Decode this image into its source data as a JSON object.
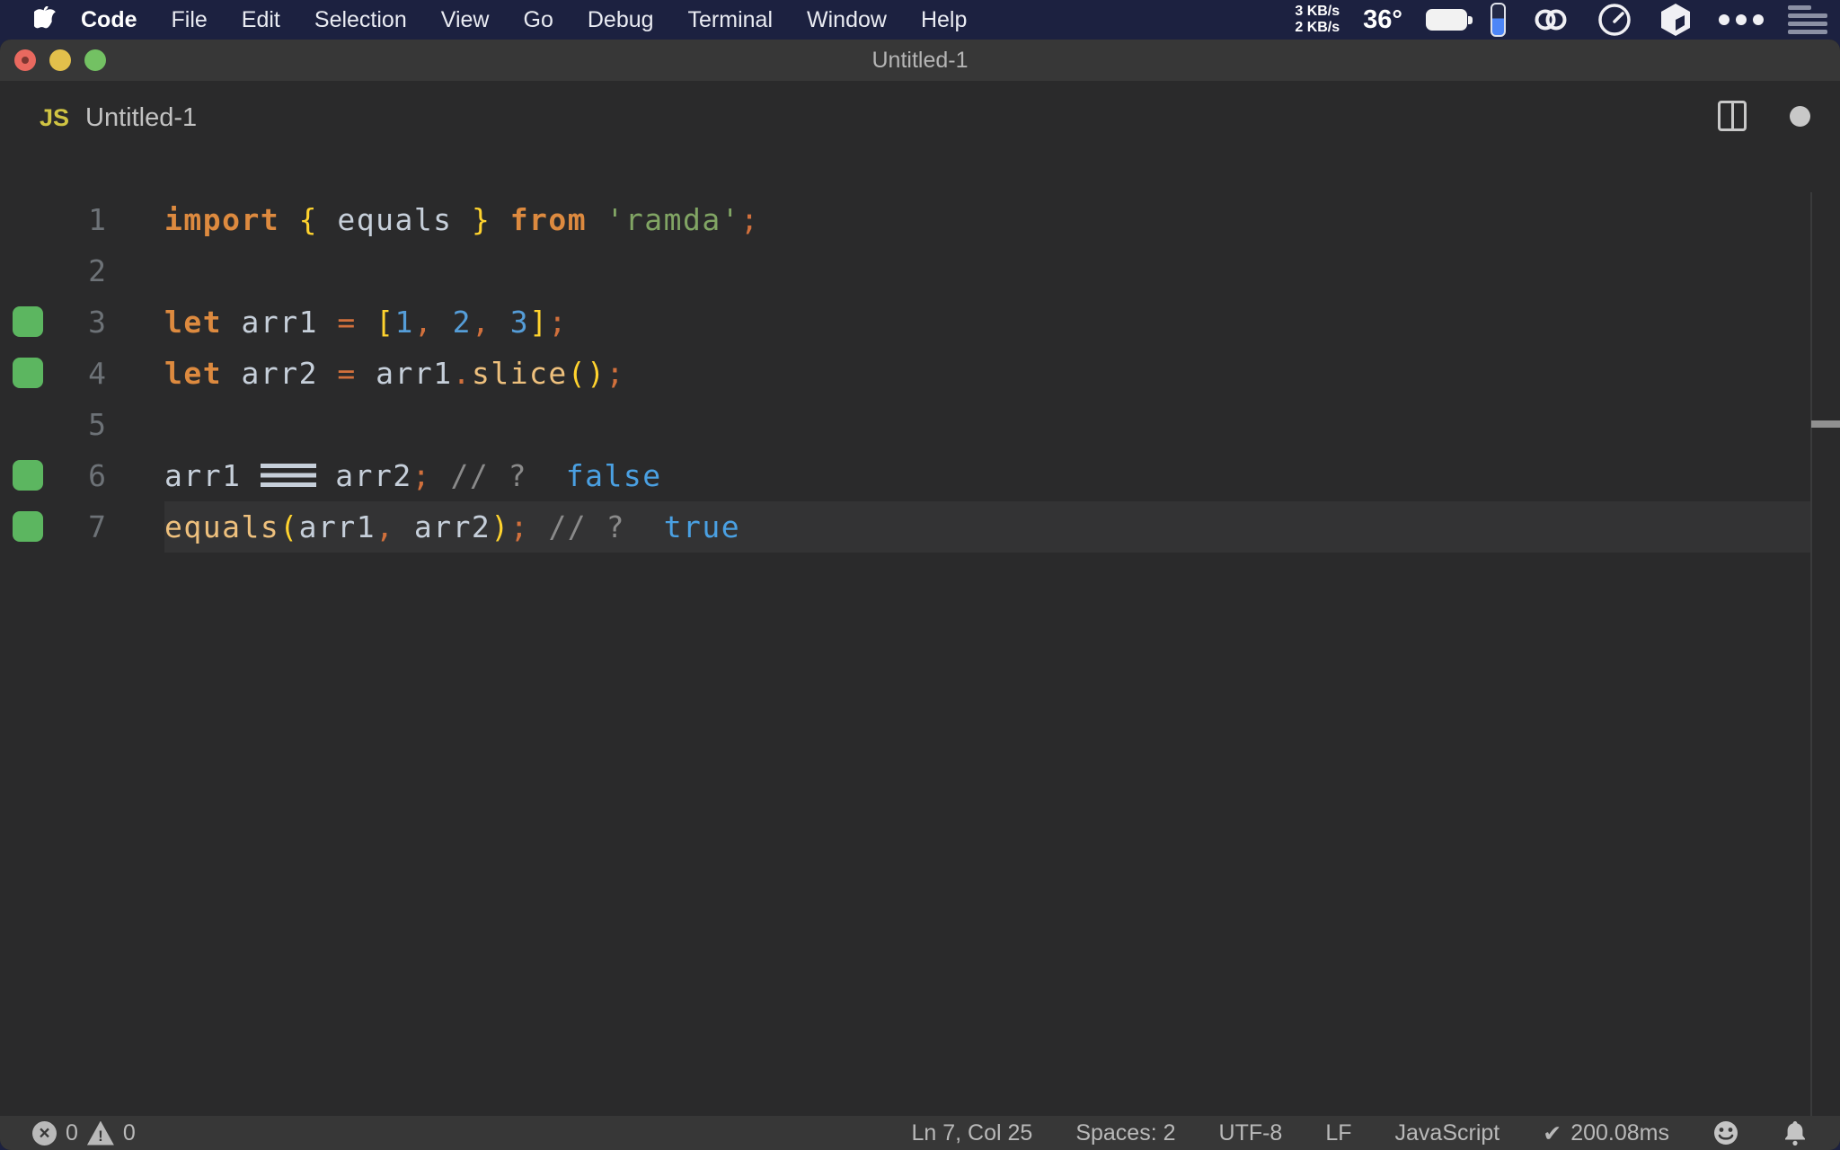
{
  "menu_bar": {
    "active_app": "Code",
    "items": [
      "Code",
      "File",
      "Edit",
      "Selection",
      "View",
      "Go",
      "Debug",
      "Terminal",
      "Window",
      "Help"
    ],
    "status": {
      "net_up": "3 KB/s",
      "net_down": "2 KB/s",
      "temperature": "36°"
    }
  },
  "window": {
    "title": "Untitled-1",
    "tab": {
      "badge": "JS",
      "label": "Untitled-1"
    }
  },
  "editor": {
    "cursor_line": 7,
    "lines": [
      {
        "num": "1",
        "covered": false,
        "current": false,
        "tokens": [
          [
            "kw",
            "import"
          ],
          [
            "pl",
            " "
          ],
          [
            "y",
            "{"
          ],
          [
            "pl",
            " "
          ],
          [
            "id",
            "equals"
          ],
          [
            "pl",
            " "
          ],
          [
            "y",
            "}"
          ],
          [
            "pl",
            " "
          ],
          [
            "kw",
            "from"
          ],
          [
            "pl",
            " "
          ],
          [
            "str",
            "'ramda'"
          ],
          [
            "op",
            ";"
          ]
        ]
      },
      {
        "num": "2",
        "covered": false,
        "current": false,
        "tokens": []
      },
      {
        "num": "3",
        "covered": true,
        "current": false,
        "tokens": [
          [
            "kw",
            "let"
          ],
          [
            "pl",
            " "
          ],
          [
            "id",
            "arr1"
          ],
          [
            "pl",
            " "
          ],
          [
            "op",
            "="
          ],
          [
            "pl",
            " "
          ],
          [
            "y",
            "["
          ],
          [
            "num",
            "1"
          ],
          [
            "op",
            ","
          ],
          [
            "pl",
            " "
          ],
          [
            "num",
            "2"
          ],
          [
            "op",
            ","
          ],
          [
            "pl",
            " "
          ],
          [
            "num",
            "3"
          ],
          [
            "y",
            "]"
          ],
          [
            "op",
            ";"
          ]
        ]
      },
      {
        "num": "4",
        "covered": true,
        "current": false,
        "tokens": [
          [
            "kw",
            "let"
          ],
          [
            "pl",
            " "
          ],
          [
            "id",
            "arr2"
          ],
          [
            "pl",
            " "
          ],
          [
            "op",
            "="
          ],
          [
            "pl",
            " "
          ],
          [
            "id",
            "arr1"
          ],
          [
            "op",
            "."
          ],
          [
            "fn",
            "slice"
          ],
          [
            "y",
            "("
          ],
          [
            "y",
            ")"
          ],
          [
            "op",
            ";"
          ]
        ]
      },
      {
        "num": "5",
        "covered": false,
        "current": false,
        "tokens": []
      },
      {
        "num": "6",
        "covered": true,
        "current": false,
        "tokens": [
          [
            "id",
            "arr1"
          ],
          [
            "pl",
            " "
          ],
          [
            "eq3",
            "==="
          ],
          [
            "pl",
            " "
          ],
          [
            "id",
            "arr2"
          ],
          [
            "op",
            ";"
          ],
          [
            "pl",
            " "
          ],
          [
            "cm",
            "//"
          ],
          [
            "pl",
            " "
          ],
          [
            "cm",
            "?"
          ],
          [
            "pl",
            "  "
          ],
          [
            "res",
            "false"
          ]
        ]
      },
      {
        "num": "7",
        "covered": true,
        "current": true,
        "tokens": [
          [
            "fn",
            "equals"
          ],
          [
            "y",
            "("
          ],
          [
            "id",
            "arr1"
          ],
          [
            "op",
            ","
          ],
          [
            "pl",
            " "
          ],
          [
            "id",
            "arr2"
          ],
          [
            "y",
            ")"
          ],
          [
            "op",
            ";"
          ],
          [
            "pl",
            " "
          ],
          [
            "cm",
            "//"
          ],
          [
            "pl",
            " "
          ],
          [
            "cm",
            "?"
          ],
          [
            "pl",
            "  "
          ],
          [
            "res",
            "true"
          ]
        ]
      }
    ]
  },
  "status_bar": {
    "errors": "0",
    "warnings": "0",
    "cursor_position": "Ln 7, Col 25",
    "indentation": "Spaces: 2",
    "encoding": "UTF-8",
    "eol": "LF",
    "language": "JavaScript",
    "check_mark": "✔",
    "perf_time": "200.08ms"
  },
  "colors": {
    "menubar_bg": "#1c2140",
    "window_chrome_bg": "#373737",
    "editor_bg": "#2a2a2b",
    "current_line_bg": "#333334",
    "coverage_green": "#5cb660",
    "keyword_orange": "#dd8a3f",
    "bracket_yellow": "#ffd32e",
    "operator_orange": "#d1703c",
    "identifier_gray": "#c6cfda",
    "number_blue": "#559dd8",
    "function_amber": "#eec07d",
    "string_green": "#81a564",
    "comment_gray": "#8a8a8a",
    "result_blue": "#4aa0e2",
    "traffic_red": "#e9695f",
    "traffic_yellow": "#e3c04b",
    "traffic_green": "#73c163",
    "js_badge_yellow": "#d0c443"
  }
}
